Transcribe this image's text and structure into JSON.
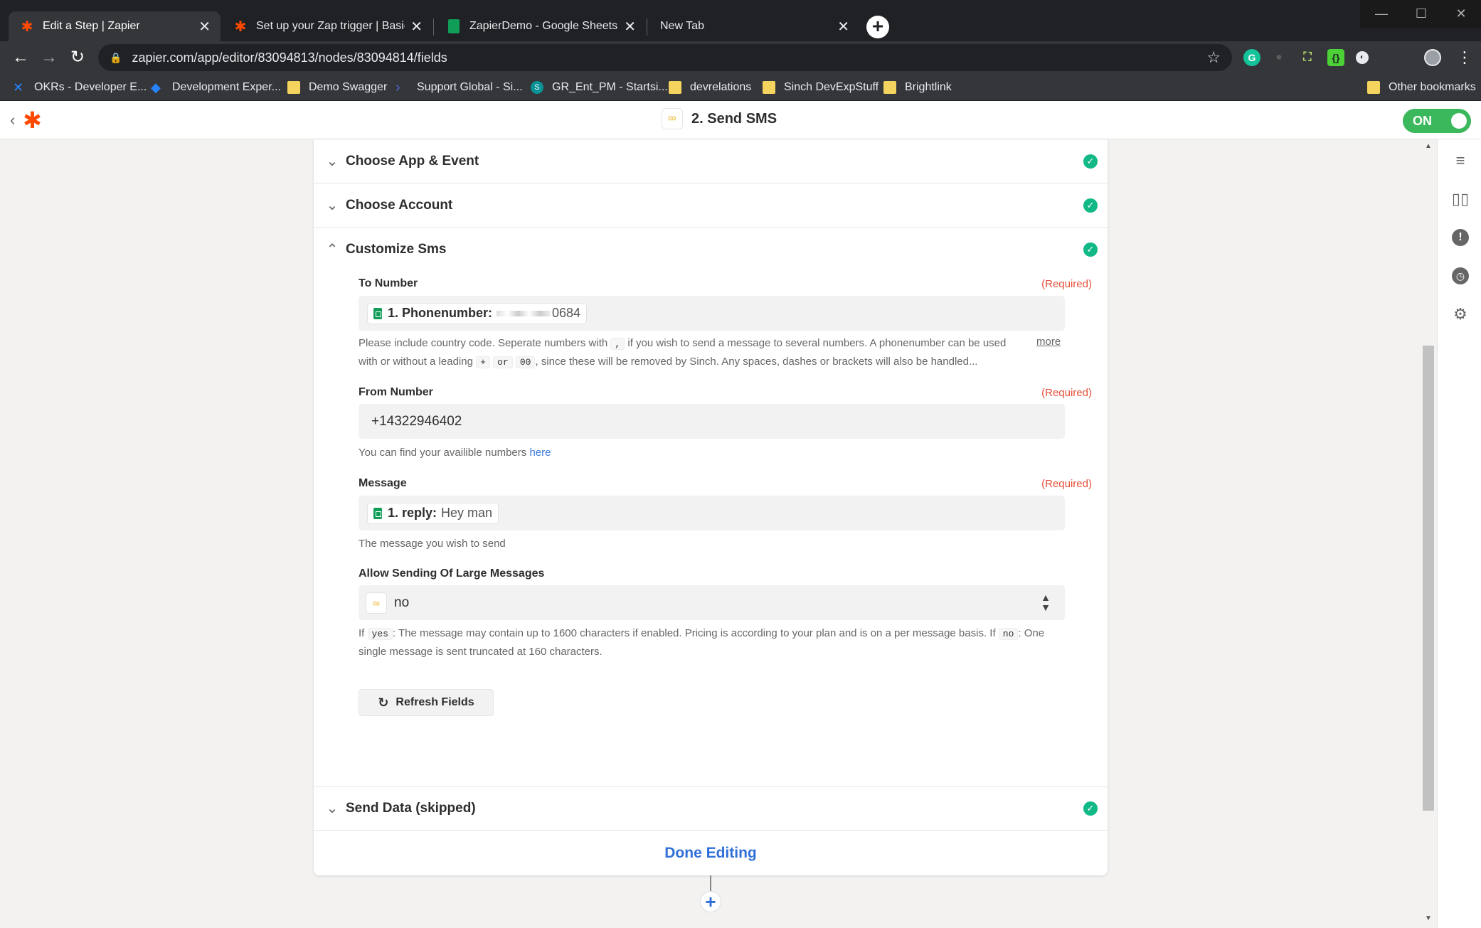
{
  "browser": {
    "tabs": [
      {
        "label": "Edit a Step | Zapier",
        "active": true
      },
      {
        "label": "Set up your Zap trigger | Basics o",
        "active": false
      },
      {
        "label": "ZapierDemo - Google Sheets",
        "active": false
      },
      {
        "label": "New Tab",
        "active": false
      }
    ],
    "url": "zapier.com/app/editor/83094813/nodes/83094814/fields",
    "bookmarks": [
      "OKRs - Developer E...",
      "Development Exper...",
      "Demo Swagger",
      "Support Global - Si...",
      "GR_Ent_PM - Startsi...",
      "devrelations",
      "Sinch DevExpStuff",
      "Brightlink"
    ],
    "other_bookmarks": "Other bookmarks"
  },
  "header": {
    "step_title": "2. Send SMS",
    "toggle_label": "ON"
  },
  "sections": {
    "choose_app": "Choose App & Event",
    "choose_account": "Choose Account",
    "customize": "Customize Sms",
    "send_data": "Send Data (skipped)"
  },
  "fields": {
    "required_label": "(Required)",
    "to_number": {
      "label": "To Number",
      "pill_key": "1. Phonenumber:",
      "pill_value": "0684",
      "help_a": "Please include country code. Seperate numbers with",
      "help_code1": ",",
      "help_b": "if you wish to send a message to several numbers. A phonenumber can be used with or without a leading",
      "help_code2": "+",
      "help_or": "or",
      "help_code3": "00",
      "help_c": ", since these will be removed by Sinch. Any spaces, dashes or brackets will also be handled...",
      "more": "more"
    },
    "from_number": {
      "label": "From Number",
      "value": "+14322946402",
      "help_text": "You can find your availible numbers",
      "help_link": "here"
    },
    "message": {
      "label": "Message",
      "pill_key": "1. reply:",
      "pill_value": "Hey man",
      "help": "The message you wish to send"
    },
    "large_messages": {
      "label": "Allow Sending Of Large Messages",
      "value": "no",
      "help_if": "If",
      "help_code_yes": "yes",
      "help_a": ": The message may contain up to 1600 characters if enabled. Pricing is according to your plan and is on a per message basis. If",
      "help_code_no": "no",
      "help_b": ": One single message is sent truncated at 160 characters."
    }
  },
  "buttons": {
    "refresh": "Refresh Fields",
    "done": "Done Editing"
  },
  "colors": {
    "zapier_orange": "#ff4a00",
    "toggle_green": "#3ab85b",
    "check_teal": "#12b886",
    "required_red": "#e5503a",
    "link_blue": "#2f6fd7"
  }
}
